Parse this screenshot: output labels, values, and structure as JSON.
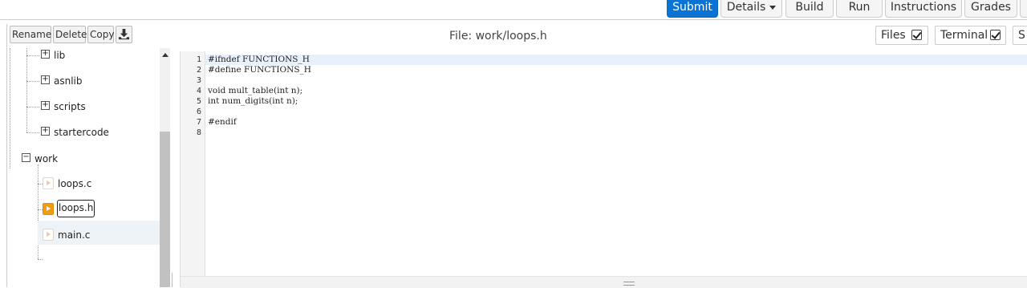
{
  "toolbar": {
    "buttons": [
      {
        "label": "Submit"
      },
      {
        "label": "Details"
      },
      {
        "label": "Build"
      },
      {
        "label": "Run"
      },
      {
        "label": "Instructions"
      },
      {
        "label": "Grades"
      }
    ]
  },
  "file_panel": {
    "rename_label": "Rename",
    "delete_label": "Delete",
    "copy_label": "Copy",
    "download_icon": "download-icon",
    "tree": [
      {
        "label": "lib",
        "type": "folder",
        "expander": "+"
      },
      {
        "label": "asnlib",
        "type": "folder",
        "expander": "+"
      },
      {
        "label": "scripts",
        "type": "folder",
        "expander": "+"
      },
      {
        "label": "startercode",
        "type": "folder",
        "expander": "+"
      },
      {
        "label": "work",
        "type": "folder",
        "expander": "−"
      },
      {
        "label": "loops.c",
        "type": "file"
      },
      {
        "label": "loops.h",
        "type": "file",
        "selected": true
      },
      {
        "label": "main.c",
        "type": "file"
      }
    ]
  },
  "header": {
    "file_title": "File: work/loops.h",
    "files_toggle": "Files",
    "terminal_toggle": "Terminal",
    "cut_toggle": "S"
  },
  "editor": {
    "line_numbers": [
      "1",
      "2",
      "3",
      "4",
      "5",
      "6",
      "7",
      "8"
    ],
    "lines": [
      "#ifndef FUNCTIONS_H",
      "#define FUNCTIONS_H",
      "",
      "void mult_table(int n);",
      "int num_digits(int n);",
      "",
      "#endif",
      ""
    ]
  },
  "colors": {
    "primary": "#0b73d4",
    "active_file": "#f39c12",
    "active_line": "#e8f0fb"
  }
}
